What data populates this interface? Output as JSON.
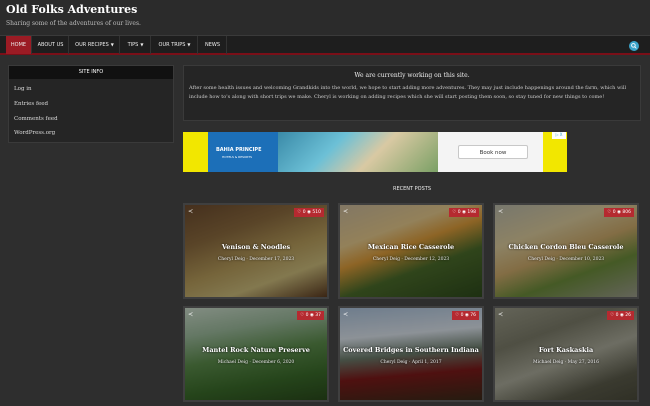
{
  "site": {
    "title": "Old Folks Adventures",
    "tagline": "Sharing some of the adventures of our lives."
  },
  "nav": {
    "items": [
      {
        "label": "HOME",
        "active": true
      },
      {
        "label": "ABOUT US"
      },
      {
        "label": "OUR RECIPES",
        "dropdown": true
      },
      {
        "label": "TIPS",
        "dropdown": true
      },
      {
        "label": "OUR TRIPS",
        "dropdown": true
      },
      {
        "label": "NEWS"
      }
    ],
    "search_icon": "search-icon"
  },
  "sidebar": {
    "title": "SITE INFO",
    "links": [
      "Log in",
      "Entries feed",
      "Comments feed",
      "WordPress.org"
    ]
  },
  "notice": {
    "title": "We are currently working on this site.",
    "body": "After some health issues and welcoming Grandkids into the world, we hope to start adding more adventures. They may just include happenings around the farm, which will include how to's along with short trips we make. Cheryl is working on adding recipes which she will start posting them soon, so stay tuned for new things to come!"
  },
  "ad": {
    "brand": "BAHIA PRINCIPE",
    "brand_sub": "HOTELS & RESORTS",
    "cta": "Book now",
    "close": "▷ X"
  },
  "recent": {
    "title": "RECENT POSTS",
    "posts": [
      {
        "title": "Venison & Noodles",
        "author": "Cheryl Deig",
        "date": "December 17, 2023",
        "likes": "0",
        "views": "510"
      },
      {
        "title": "Mexican Rice Casserole",
        "author": "Cheryl Deig",
        "date": "December 12, 2023",
        "likes": "0",
        "views": "198"
      },
      {
        "title": "Chicken Cordon Bleu Casserole",
        "author": "Cheryl Deig",
        "date": "December 10, 2023",
        "likes": "0",
        "views": "806"
      },
      {
        "title": "Mantel Rock Nature Preserve",
        "author": "Michael Deig",
        "date": "December 6, 2020",
        "likes": "0",
        "views": "37"
      },
      {
        "title": "Covered Bridges in Southern Indiana",
        "author": "Cheryl Deig",
        "date": "April 1, 2017",
        "likes": "0",
        "views": "76"
      },
      {
        "title": "Fort Kaskaskia",
        "author": "Michael Deig",
        "date": "May 27, 2016",
        "likes": "0",
        "views": "26"
      }
    ]
  },
  "colors": {
    "accent": "#9b1b24",
    "badge": "#b52a30",
    "search": "#3aa3c9"
  }
}
